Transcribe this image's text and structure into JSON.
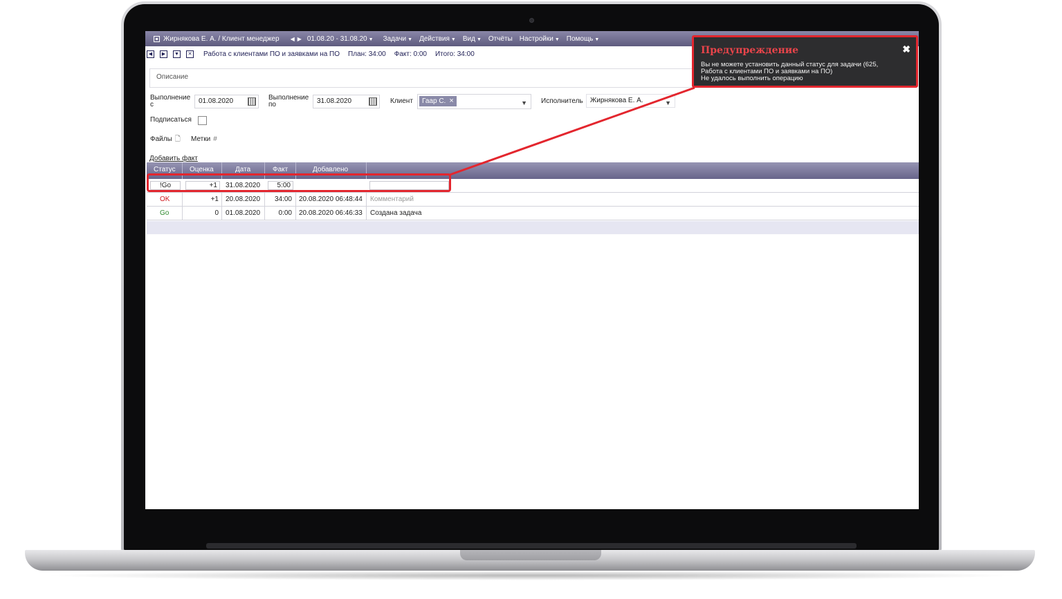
{
  "menubar": {
    "crumb": "Жирнякова Е. А. / Клиент менеджер",
    "period": "01.08.20 - 31.08.20",
    "menus": [
      "Задачи",
      "Действия",
      "Вид",
      "Отчёты",
      "Настройки",
      "Помощь"
    ]
  },
  "task": {
    "title": "Работа с клиентами ПО и заявками на ПО",
    "plan": "План: 34:00",
    "fact": "Факт: 0:00",
    "total": "Итого: 34:00"
  },
  "form": {
    "description_placeholder": "Описание",
    "from_label_1": "Выполнение",
    "from_label_2": "с",
    "from_value": "01.08.2020",
    "to_label_1": "Выполнение",
    "to_label_2": "по",
    "to_value": "31.08.2020",
    "client_label": "Клиент",
    "client_tag": "Гаар С.",
    "client_tag_remove": "×",
    "executor_label": "Исполнитель",
    "executor_value": "Жирнякова Е. А.",
    "subscribe_label": "Подписаться",
    "files_label": "Файлы",
    "tags_label": "Метки",
    "add_fact_link": "Добавить факт"
  },
  "grid": {
    "columns": [
      "Статус",
      "Оценка",
      "Дата",
      "Факт",
      "Добавлено"
    ],
    "edit_row": {
      "status": "!Go",
      "estimate": "+1",
      "date": "31.08.2020",
      "fact": "5:00"
    },
    "rows": [
      {
        "status": "OK",
        "estimate": "+1",
        "date": "20.08.2020",
        "fact": "34:00",
        "added": "20.08.2020 06:48:44",
        "comment": "Комментарий"
      },
      {
        "status": "Go",
        "estimate": "0",
        "date": "01.08.2020",
        "fact": "0:00",
        "added": "20.08.2020 06:46:33",
        "comment": "Создана задача"
      }
    ]
  },
  "warning": {
    "title": "Предупреждение",
    "close": "✖",
    "line1": "Вы не можете установить данный статус для задачи (625,",
    "line2": "Работа с клиентами ПО и заявками на ПО)",
    "line3": "Не удалось выполнить операцию"
  },
  "colors": {
    "accent_red": "#e3262e",
    "status_ok": "#d0191f",
    "status_go": "#2f8a2f",
    "menubar": "#6b6890"
  }
}
